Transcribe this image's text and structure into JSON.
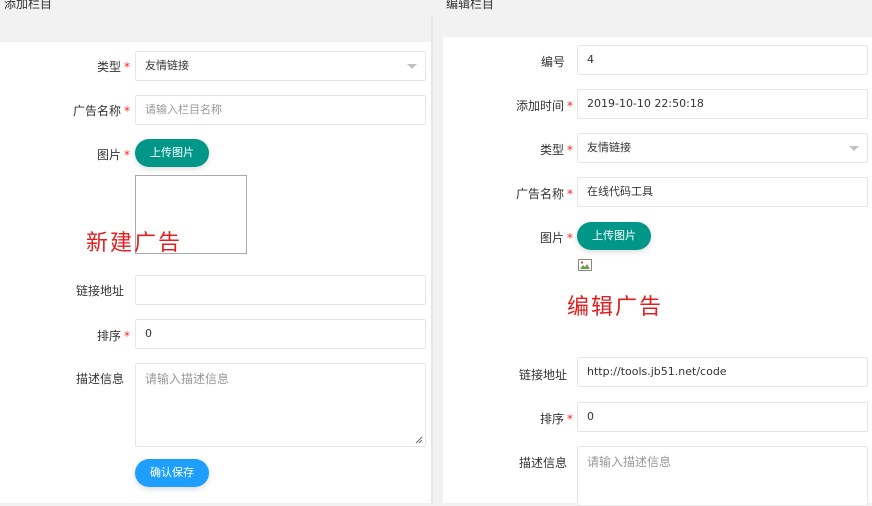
{
  "add_form": {
    "panel_title": "添加栏目",
    "type": {
      "label": "类型",
      "value": "友情链接"
    },
    "ad_name": {
      "label": "广告名称",
      "placeholder": "请输入栏目名称"
    },
    "image": {
      "label": "图片",
      "upload_label": "上传图片"
    },
    "watermark": "新建广告",
    "link": {
      "label": "链接地址",
      "value": ""
    },
    "sort": {
      "label": "排序",
      "value": "0"
    },
    "description": {
      "label": "描述信息",
      "placeholder": "请输入描述信息"
    },
    "submit_label": "确认保存"
  },
  "edit_form": {
    "panel_title": "编辑栏目",
    "id": {
      "label": "编号",
      "value": "4"
    },
    "added_time": {
      "label": "添加时间",
      "value": "2019-10-10 22:50:18"
    },
    "type": {
      "label": "类型",
      "value": "友情链接"
    },
    "ad_name": {
      "label": "广告名称",
      "value": "在线代码工具"
    },
    "image": {
      "label": "图片",
      "upload_label": "上传图片"
    },
    "watermark": "编辑广告",
    "link": {
      "label": "链接地址",
      "value": "http://tools.jb51.net/code"
    },
    "sort": {
      "label": "排序",
      "value": "0"
    },
    "description": {
      "label": "描述信息",
      "placeholder": "请输入描述信息"
    }
  },
  "colors": {
    "required": "#ff2424",
    "upload_button": "#009688",
    "submit_button": "#1e9fff",
    "watermark": "#e02020"
  }
}
